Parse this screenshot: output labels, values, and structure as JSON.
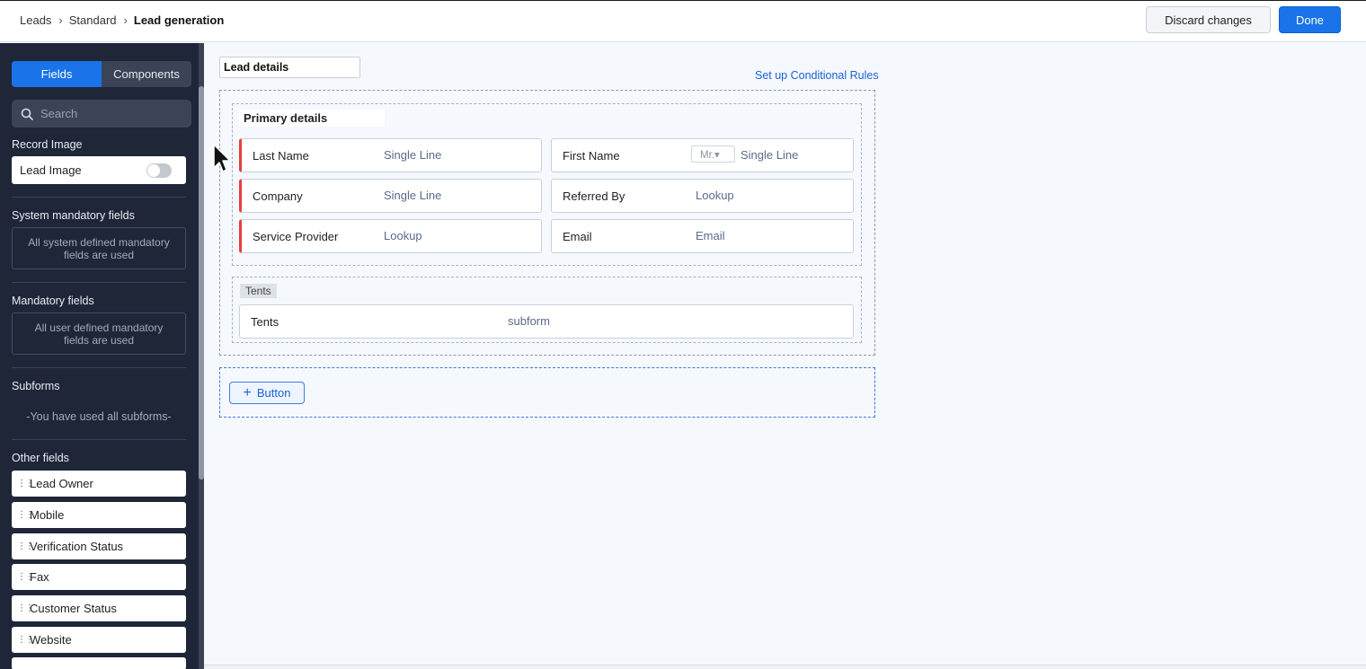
{
  "breadcrumb": [
    "Leads",
    "Standard",
    "Lead generation"
  ],
  "header": {
    "discard_label": "Discard changes",
    "done_label": "Done"
  },
  "sidebar": {
    "tabs": [
      "Fields",
      "Components"
    ],
    "active_tab": "Fields",
    "search_placeholder": "Search",
    "record_image": {
      "title": "Record Image",
      "item": "Lead Image"
    },
    "system_mandatory": {
      "title": "System mandatory fields",
      "note": "All system defined mandatory fields are used"
    },
    "mandatory": {
      "title": "Mandatory fields",
      "note": "All user defined mandatory fields are used"
    },
    "subforms": {
      "title": "Subforms",
      "note": "-You have used all subforms-"
    },
    "other_fields": {
      "title": "Other fields",
      "items": [
        "Lead Owner",
        "Mobile",
        "Verification Status",
        "Fax",
        "Customer Status",
        "Website"
      ]
    }
  },
  "canvas": {
    "section_name": "Lead details",
    "conditional_link": "Set up Conditional Rules",
    "primary_title": "Primary details",
    "fields": [
      {
        "label": "Last Name",
        "type": "Single Line"
      },
      {
        "label": "First Name",
        "type": "Single Line",
        "salutation": "Mr.▾"
      },
      {
        "label": "Company",
        "type": "Single Line"
      },
      {
        "label": "Referred By",
        "type": "Lookup"
      },
      {
        "label": "Service Provider",
        "type": "Lookup"
      },
      {
        "label": "Email",
        "type": "Email"
      }
    ],
    "subform": {
      "tag": "Tents",
      "label": "Tents",
      "type": "subform"
    },
    "button_label": "Button"
  },
  "colors": {
    "accent": "#1a73e8",
    "sidebar_bg": "#1e2638",
    "mandatory_marker": "#e5403b",
    "link": "#1a62d6"
  }
}
